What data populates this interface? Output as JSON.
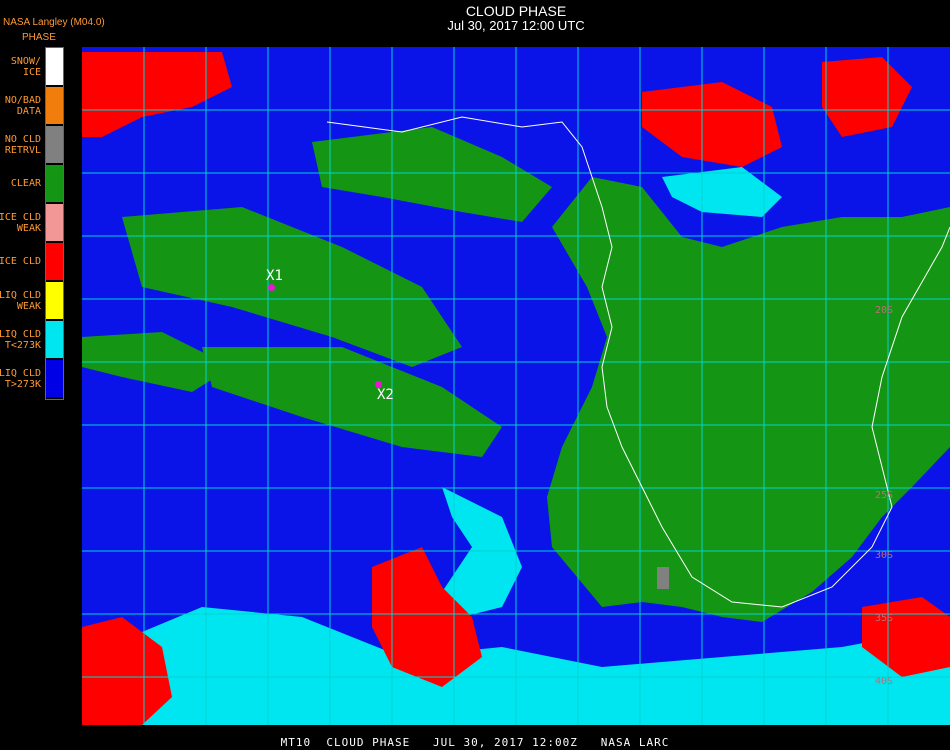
{
  "header": {
    "title": "CLOUD PHASE",
    "subtitle": "Jul 30, 2017 12:00 UTC",
    "provider": "NASA Langley (M04.0)"
  },
  "legend": {
    "title": "PHASE",
    "items": [
      {
        "label": "SNOW/\nICE",
        "color": "#ffffff"
      },
      {
        "label": "NO/BAD\nDATA",
        "color": "#f07d0c"
      },
      {
        "label": "NO CLD\nRETRVL",
        "color": "#808080"
      },
      {
        "label": "CLEAR",
        "color": "#149614"
      },
      {
        "label": "ICE CLD\nWEAK",
        "color": "#f39696"
      },
      {
        "label": "ICE CLD",
        "color": "#ff0000"
      },
      {
        "label": "LIQ CLD\nWEAK",
        "color": "#ffff00"
      },
      {
        "label": "LIQ CLD\nT<273K",
        "color": "#00e6f0"
      },
      {
        "label": "LIQ CLD\nT>273K",
        "color": "#0000e6"
      }
    ]
  },
  "markers": [
    {
      "label": "X1"
    },
    {
      "label": "X2"
    }
  ],
  "latitude_labels": [
    "20S",
    "25S",
    "30S",
    "35S",
    "40S"
  ],
  "footer": {
    "text": "MT10  CLOUD PHASE   JUL 30, 2017 12:00Z   NASA LARC"
  },
  "colors": {
    "liq_warm": "#0a14e8",
    "liq_cold": "#00e6f0",
    "ice": "#ff0000",
    "clear": "#149614",
    "liq_weak": "#ffff00",
    "no_retrieval": "#808080",
    "grid": "#00d2d2",
    "coastline": "#ffffff",
    "marker": "#e51ad0"
  }
}
